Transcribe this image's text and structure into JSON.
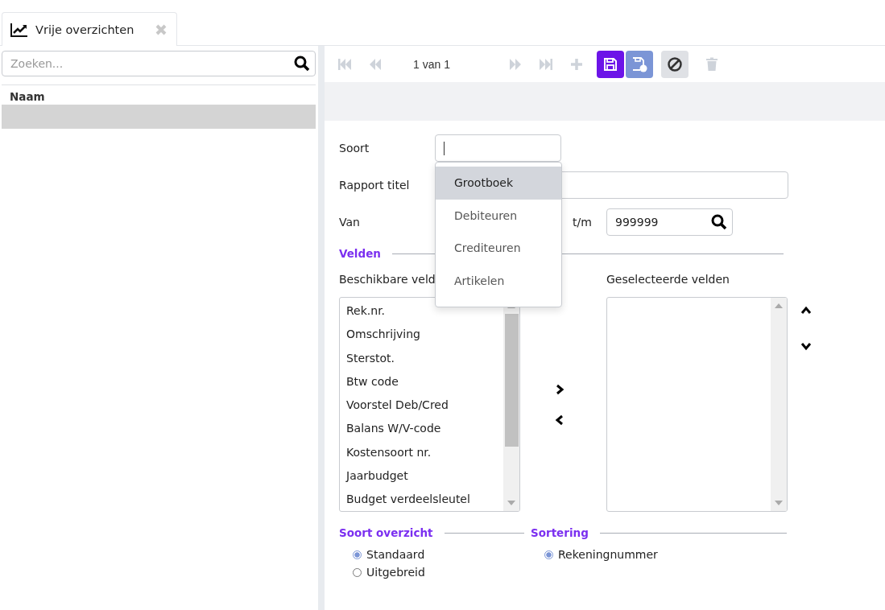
{
  "tab": {
    "title": "Vrije overzichten"
  },
  "sidebar": {
    "search": {
      "placeholder": "Zoeken..."
    },
    "column": "Naam",
    "rows": [
      {
        "selected": true
      }
    ]
  },
  "toolbar": {
    "buttons": [
      {
        "kind": "first",
        "disabled": true
      },
      {
        "kind": "prev",
        "disabled": true
      },
      {
        "kind": "counter",
        "text": "1 van 1"
      },
      {
        "kind": "next",
        "disabled": true
      },
      {
        "kind": "last",
        "disabled": true
      },
      {
        "kind": "add",
        "disabled": true
      },
      {
        "kind": "save",
        "disabled": false
      },
      {
        "kind": "save-new",
        "disabled": false
      },
      {
        "kind": "cancel",
        "disabled": false
      },
      {
        "kind": "delete",
        "disabled": true
      }
    ]
  },
  "form": {
    "soort": {
      "label": "Soort"
    },
    "titel": {
      "label": "Rapport titel"
    },
    "van": {
      "label": "Van"
    },
    "tm": {
      "label": "t/m",
      "value": "999999"
    }
  },
  "dropdown": [
    {
      "label": "Grootboek",
      "selected": true
    },
    {
      "label": "Debiteuren",
      "selected": false
    },
    {
      "label": "Crediteuren",
      "selected": false
    },
    {
      "label": "Artikelen",
      "selected": false
    }
  ],
  "velden": {
    "title": "Velden",
    "available_label": "Beschikbare veld",
    "selected_label": "Geselecteerde velden",
    "available": [
      "Rek.nr.",
      "Omschrijving",
      "Sterstot.",
      "Btw code",
      "Voorstel Deb/Cred",
      "Balans W/V-code",
      "Kostensoort nr.",
      "Jaarbudget",
      "Budget verdeelsleutel"
    ]
  },
  "soort_overzicht": {
    "title": "Soort overzicht",
    "options": [
      {
        "label": "Standaard",
        "selected": true
      },
      {
        "label": "Uitgebreid",
        "selected": false
      }
    ]
  },
  "sortering": {
    "title": "Sortering",
    "options": [
      {
        "label": "Rekeningnummer",
        "selected": true
      }
    ]
  }
}
